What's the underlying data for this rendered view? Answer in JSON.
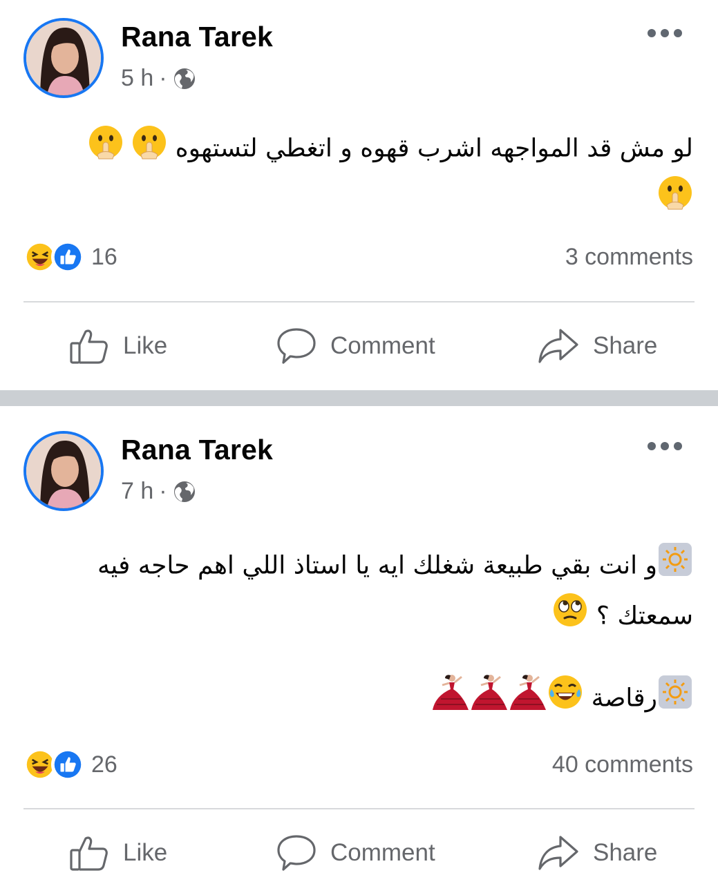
{
  "colors": {
    "accent": "#1877f2",
    "secondary_text": "#65676b",
    "divider": "#cbcfd3"
  },
  "posts": [
    {
      "author": "Rana Tarek",
      "time": "5 h",
      "separator": "·",
      "privacy_icon": "globe-icon",
      "text_lines": [
        "لو مش قد المواجهه اشرب قهوه و اتغطي لتستهوه",
        ""
      ],
      "text_emojis": [
        "shushing-face",
        "shushing-face",
        "shushing-face"
      ],
      "reactions": [
        "haha",
        "like"
      ],
      "reaction_count": "16",
      "comments": "3 comments",
      "actions": {
        "like": "Like",
        "comment": "Comment",
        "share": "Share"
      }
    },
    {
      "author": "Rana Tarek",
      "time": "7 h",
      "separator": "·",
      "privacy_icon": "globe-icon",
      "text_lines": [
        "و انت بقي طبيعة شغلك ايه يا استاذ اللي اهم حاجه فيه",
        "سمعتك ؟",
        "رقاصة"
      ],
      "text_emojis": [
        "sun-box",
        "face-with-rolling-eyes",
        "sun-box",
        "tears-of-joy",
        "dancer",
        "dancer",
        "dancer"
      ],
      "reactions": [
        "haha",
        "like"
      ],
      "reaction_count": "26",
      "comments": "40 comments",
      "actions": {
        "like": "Like",
        "comment": "Comment",
        "share": "Share"
      }
    }
  ]
}
